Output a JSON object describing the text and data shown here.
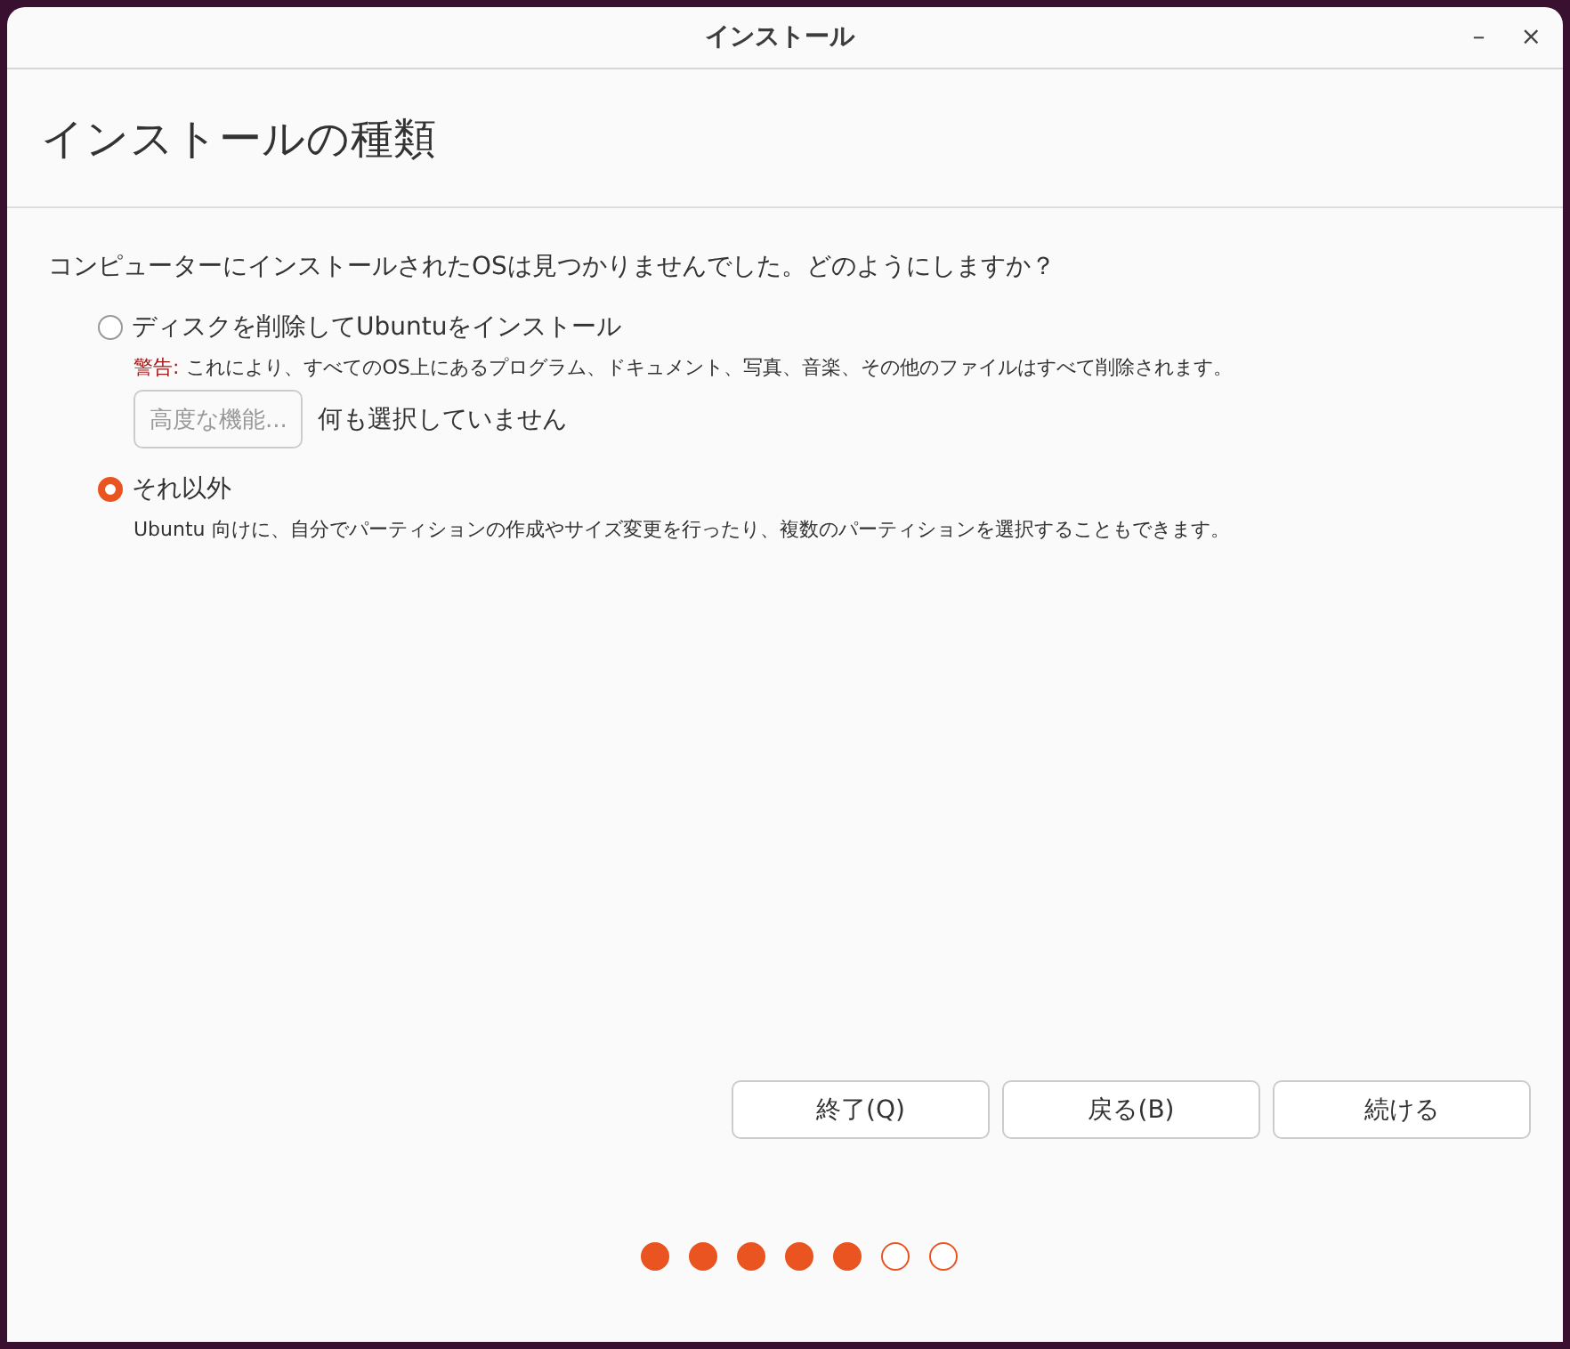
{
  "window": {
    "title": "インストール",
    "controls": [
      "–",
      "×"
    ]
  },
  "heading": "インストールの種類",
  "question": "コンピューターにインストールされたOSは見つかりませんでした。どのようにしますか？",
  "options": [
    {
      "label": "ディスクを削除してUbuntuをインストール",
      "selected": false,
      "warning_label": "警告:",
      "description": "これにより、すべてのOS上にあるプログラム、ドキュメント、写真、音楽、その他のファイルはすべて削除されます。",
      "advanced": {
        "label": "高度な機能...",
        "disabled": true,
        "status": "何も選択していません"
      }
    },
    {
      "label": "それ以外",
      "selected": true,
      "description": "Ubuntu 向けに、自分でパーティションの作成やサイズ変更を行ったり、複数のパーティションを選択することもできます。"
    }
  ],
  "buttons": [
    "終了(Q)",
    "戻る(B)",
    "続ける"
  ],
  "progress": [
    {
      "filled": true
    },
    {
      "filled": true
    },
    {
      "filled": true
    },
    {
      "filled": true
    },
    {
      "filled": true
    },
    {
      "filled": false
    },
    {
      "filled": false
    }
  ]
}
